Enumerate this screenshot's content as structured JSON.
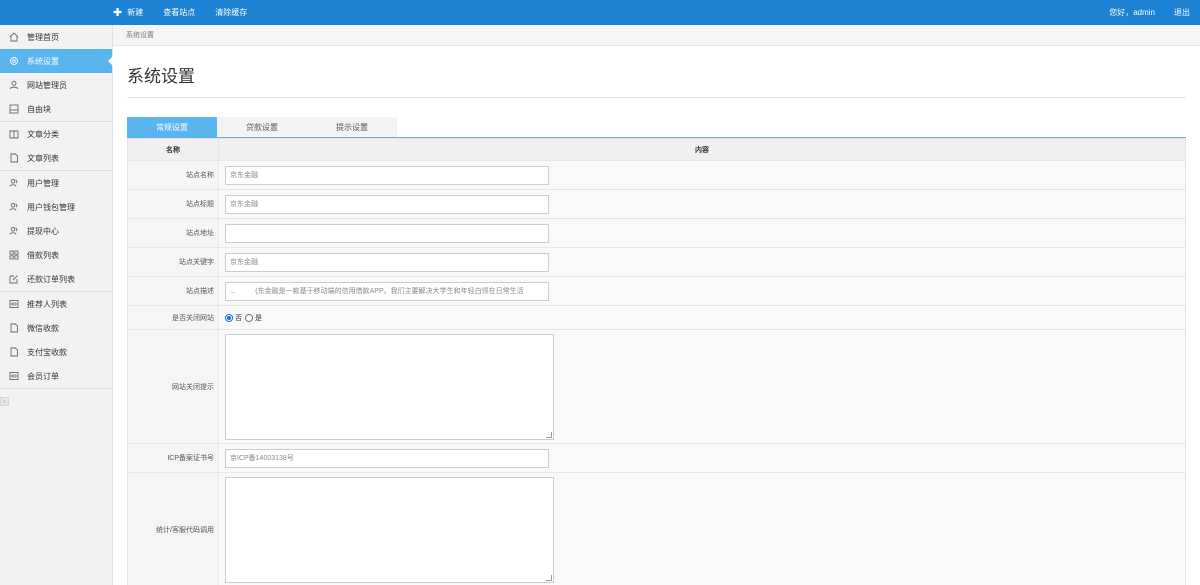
{
  "topbar": {
    "new_label": "新建",
    "view_site_label": "查看站点",
    "clear_cache_label": "清除缓存",
    "greeting": "您好，admin",
    "logout_label": "退出"
  },
  "sidebar": {
    "items": [
      {
        "label": "管理首页",
        "icon": "home-icon"
      },
      {
        "label": "系统设置",
        "icon": "gear-icon"
      },
      {
        "label": "网站管理员",
        "icon": "user-icon"
      },
      {
        "label": "自由块",
        "icon": "block-icon"
      },
      {
        "label": "文章分类",
        "icon": "book-icon"
      },
      {
        "label": "文章列表",
        "icon": "file-icon"
      },
      {
        "label": "用户管理",
        "icon": "users-icon"
      },
      {
        "label": "用户钱包管理",
        "icon": "users-icon"
      },
      {
        "label": "提现中心",
        "icon": "users-icon"
      },
      {
        "label": "借款列表",
        "icon": "grid-icon"
      },
      {
        "label": "还款订单列表",
        "icon": "edit-icon"
      },
      {
        "label": "推荐人列表",
        "icon": "card-icon"
      },
      {
        "label": "微信收款",
        "icon": "file-icon"
      },
      {
        "label": "支付宝收款",
        "icon": "file-icon"
      },
      {
        "label": "会员订单",
        "icon": "card-icon"
      }
    ]
  },
  "breadcrumb": "系统设置",
  "page_title": "系统设置",
  "tabs": [
    "常规设置",
    "贷款设置",
    "提示设置"
  ],
  "table": {
    "head_name": "名称",
    "head_content": "内容",
    "rows": {
      "site_name": {
        "label": "站点名称",
        "value": "京东金融"
      },
      "site_title": {
        "label": "站点标题",
        "value": "京东金融"
      },
      "site_url": {
        "label": "站点地址",
        "value": ""
      },
      "site_keywords": {
        "label": "站点关键字",
        "value": "京东金融"
      },
      "site_desc": {
        "label": "站点描述",
        "value": "...          (东金融是一款基于移动端的信用借款APP。我们主要解决大学生和年轻白领在日常生活"
      },
      "site_close": {
        "label": "是否关闭网站",
        "option_no": "否",
        "option_yes": "是"
      },
      "close_tip": {
        "label": "网站关闭提示",
        "value": ""
      },
      "icp": {
        "label": "ICP备案证书号",
        "value": "京ICP备14003138号"
      },
      "stats_code": {
        "label": "统计/客服代码调用",
        "value": ""
      }
    }
  },
  "colors": {
    "topbar": "#1c82d4",
    "active": "#5ab4ee"
  }
}
